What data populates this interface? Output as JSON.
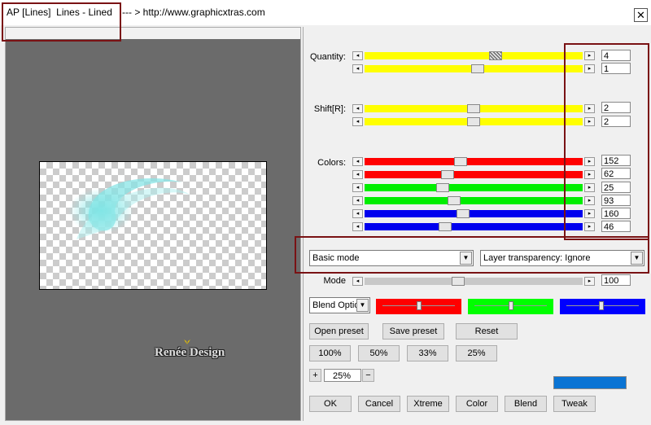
{
  "window": {
    "title": "AP [Lines]  Lines - Lined",
    "url_text": "--- > http://www.graphicxtras.com",
    "close_label": "✕"
  },
  "logo": {
    "text": "Renée Design"
  },
  "labels": {
    "quantity": "Quantity:",
    "shift": "Shift[R]:",
    "colors": "Colors:",
    "mode": "Mode"
  },
  "sliders": {
    "quantity": [
      {
        "value": "4",
        "fraction": 0.6,
        "hatched": true
      },
      {
        "value": "1",
        "fraction": 0.52
      }
    ],
    "shift": [
      {
        "value": "2",
        "fraction": 0.5
      },
      {
        "value": "2",
        "fraction": 0.5
      }
    ],
    "colors": [
      {
        "value": "152",
        "fraction": 0.44,
        "color": "#ff0000"
      },
      {
        "value": "62",
        "fraction": 0.38,
        "color": "#ff0000"
      },
      {
        "value": "25",
        "fraction": 0.36,
        "color": "#00ee00"
      },
      {
        "value": "93",
        "fraction": 0.41,
        "color": "#00ee00"
      },
      {
        "value": "160",
        "fraction": 0.45,
        "color": "#0000ee"
      },
      {
        "value": "46",
        "fraction": 0.37,
        "color": "#0000ee"
      }
    ],
    "mode": {
      "value": "100",
      "fraction": 0.43
    }
  },
  "dropdowns": {
    "mode": "Basic mode",
    "transparency": "Layer transparency: Ignore",
    "blend": "Blend Optio"
  },
  "color_bars": [
    {
      "color": "#ff0000",
      "fraction": 0.5
    },
    {
      "color": "#00ff00",
      "fraction": 0.5
    },
    {
      "color": "#0000ff",
      "fraction": 0.48
    }
  ],
  "buttons": {
    "open_preset": "Open preset",
    "save_preset": "Save preset",
    "reset": "Reset",
    "z100": "100%",
    "z50": "50%",
    "z33": "33%",
    "z25": "25%",
    "plus": "+",
    "minus": "−",
    "zoom_value": "25%",
    "ok": "OK",
    "cancel": "Cancel",
    "xtreme": "Xtreme",
    "color": "Color",
    "blend": "Blend",
    "tweak": "Tweak"
  },
  "colors": {
    "slider_yellow": "#ffff00",
    "accent_blue": "#0a74d4",
    "annotation": "#7a1214"
  }
}
